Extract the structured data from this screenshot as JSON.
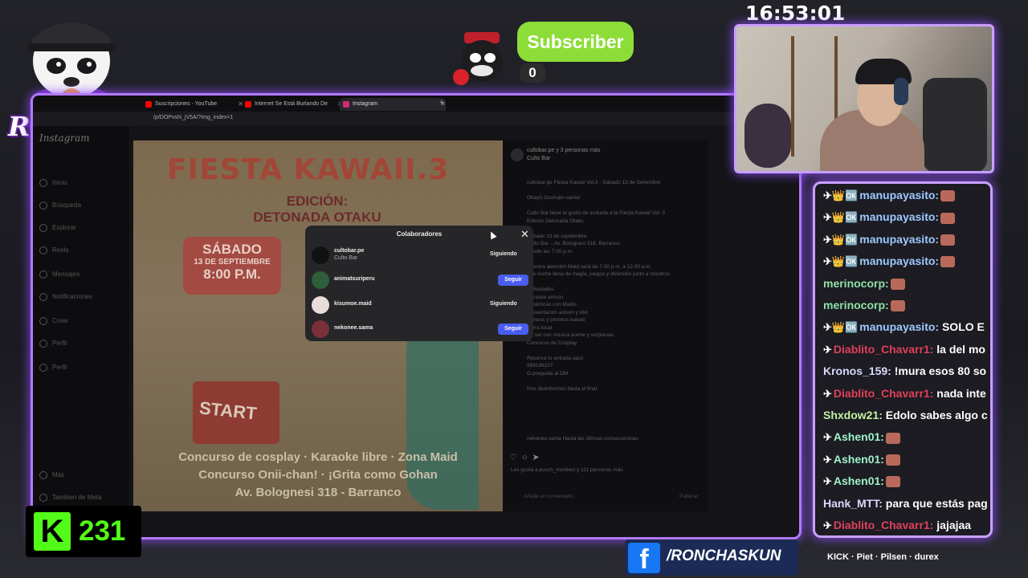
{
  "clock": "16:53:01",
  "logo": {
    "text": "RONCHAS"
  },
  "subscriber": {
    "label": "Subscriber",
    "count": "0"
  },
  "browser": {
    "tabs": [
      {
        "title": "Suscripciones - YouTube",
        "fav_color": "#ff0000"
      },
      {
        "title": "Internet Se Está Burlando De",
        "fav_color": "#ff0000"
      },
      {
        "title": "Instagram",
        "fav_color": "#d62976"
      }
    ],
    "url": "/p/DOPvsN_jV5A/?img_index=1"
  },
  "instagram": {
    "logo": "Instagram",
    "nav": [
      "Inicio",
      "Búsqueda",
      "Explorar",
      "Reels",
      "Mensajes",
      "Notificaciones",
      "Crear",
      "Perfil",
      "Perfil",
      "Más",
      "Tambien de Meta"
    ],
    "post_header": "cultobar.pe y 3 personas más",
    "post_sub": "Culto Bar",
    "caption": "cultobar.pe Fiesta Kawaii Vol.3 - Sábado 13 de Setiembre\n\nOhayō Goshujin-sama!\n\nCulto Bar tiene el gusto de invitarte a la Fiesta Kawaii Vol. 3\nEdición Detonada Otaku\n\nSábado 13 de septiembre\nCulto Bar – Av. Bolognesi 318, Barranco\nDesde las 7:00 p.m.\n\nNuestra atención Maid será de 7:30 p.m. a 12:00 a.m.\nuna noche llena de magia, juegos y diversión junto a nosotros\n\nActividades:\nKaraoke anison\nDinámicas con Maids\nPresentación anison y idol\nSorteos y premios kawaii\nBarra local\nDJ set con música anime y sorpresas\nConcurso de Cosplay\n\nReserva tu entrada aquí:\n999196107\nO pregunta al DM\n\nNos divertiremos hasta el final",
    "comment": "nekonee.sama Hasta las últimas consecuencias",
    "likes": "Les gusta a pusch_morteen y 111 personas más",
    "comment_placeholder": "Añade un comentario...",
    "publish": "Publicar"
  },
  "poster": {
    "title": "FIESTA KAWAII.3",
    "edition": "EDICIÓN: DETONADA OTAKU",
    "date_day": "SÁBADO",
    "date_line": "13 DE SEPTIEMBRE",
    "date_time": "8:00 P.M.",
    "start": "START",
    "line1": "Concurso de cosplay · Karaoke libre · Zona Maid",
    "line2": "Concurso Onii-chan! · ¡Grita como Gohan",
    "line3": "Av. Bolognesi 318 - Barranco"
  },
  "modal": {
    "title": "Colaboradores",
    "collaborators": [
      {
        "name": "cultobar.pe",
        "sub": "Culto Bar",
        "action": "Siguiendo",
        "following": true,
        "avatar_color": "#111111"
      },
      {
        "name": "animatsuriperu",
        "sub": "",
        "action": "Seguir",
        "following": false,
        "avatar_color": "#2f5f3a"
      },
      {
        "name": "kisumoe.maid",
        "sub": "",
        "action": "Siguiendo",
        "following": true,
        "avatar_color": "#e8ddd8"
      },
      {
        "name": "nekonee.sama",
        "sub": "",
        "action": "Seguir",
        "following": false,
        "avatar_color": "#7a2f3a"
      }
    ]
  },
  "chat": {
    "messages": [
      {
        "badges": "✈👑🆗",
        "user": "manupayasito:",
        "color": "#9ec8ff",
        "text": "",
        "emote": true
      },
      {
        "badges": "✈👑🆗",
        "user": "manupayasito:",
        "color": "#9ec8ff",
        "text": "",
        "emote": true
      },
      {
        "badges": "✈👑🆗",
        "user": "manupayasito:",
        "color": "#9ec8ff",
        "text": "",
        "emote": true
      },
      {
        "badges": "✈👑🆗",
        "user": "manupayasito:",
        "color": "#9ec8ff",
        "text": "",
        "emote": true
      },
      {
        "badges": "",
        "user": "merinocorp:",
        "color": "#8fe0a6",
        "text": "",
        "emote": true
      },
      {
        "badges": "",
        "user": "merinocorp:",
        "color": "#8fe0a6",
        "text": "",
        "emote": true
      },
      {
        "badges": "✈👑🆗",
        "user": "manupayasito:",
        "color": "#9ec8ff",
        "text": "SOLO E",
        "emote": false
      },
      {
        "badges": "✈",
        "user": "Diablito_Chavarr1:",
        "color": "#e0405a",
        "text": "la del mo",
        "emote": false
      },
      {
        "badges": "",
        "user": "Kronos_159:",
        "color": "#d9d9ff",
        "text": "!mura esos 80 so",
        "emote": false
      },
      {
        "badges": "✈",
        "user": "Diablito_Chavarr1:",
        "color": "#e0405a",
        "text": "nada inte",
        "emote": false
      },
      {
        "badges": "",
        "user": "Shxdow21:",
        "color": "#c6f0a2",
        "text": "Edolo sabes algo c",
        "emote": false
      },
      {
        "badges": "✈",
        "user": "Ashen01:",
        "color": "#9ff2c9",
        "text": "",
        "emote": true
      },
      {
        "badges": "✈",
        "user": "Ashen01:",
        "color": "#9ff2c9",
        "text": "",
        "emote": true
      },
      {
        "badges": "✈",
        "user": "Ashen01:",
        "color": "#9ff2c9",
        "text": "",
        "emote": true
      },
      {
        "badges": "",
        "user": "Hank_MTT:",
        "color": "#d9d9ff",
        "text": "para que estás pag",
        "emote": false
      },
      {
        "badges": "✈",
        "user": "Diablito_Chavarr1:",
        "color": "#e0405a",
        "text": "jajajaa",
        "emote": false
      }
    ]
  },
  "kick": {
    "letter": "K",
    "viewers": "231"
  },
  "facebook": {
    "letter": "f",
    "handle": "/RONCHASKUN"
  },
  "sponsors": "KICK · Piet · Pilsen · durex",
  "colors": {
    "accent": "#b478ff",
    "kick": "#53fc18",
    "subscriber": "#8ddd38",
    "facebook": "#1877f2"
  }
}
